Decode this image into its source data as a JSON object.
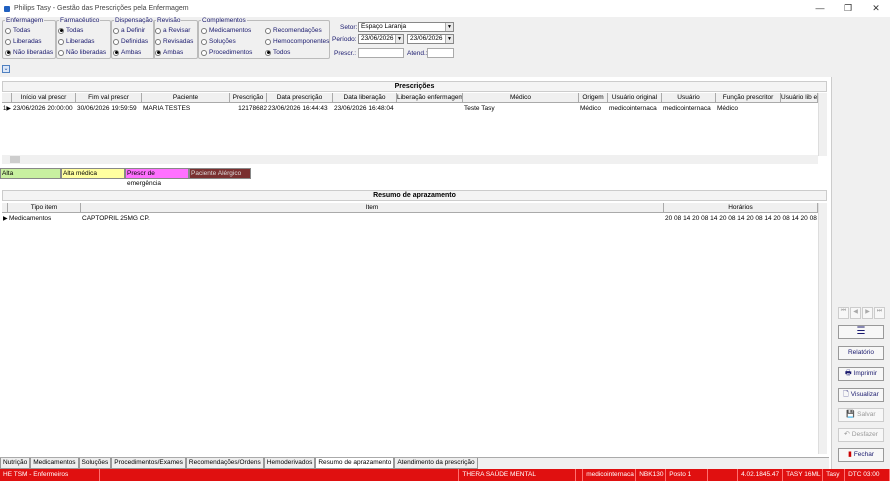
{
  "window": {
    "title": "Philips Tasy - Gestão das Prescrições pela Enfermagem",
    "controls": [
      "—",
      "❐",
      "✕"
    ]
  },
  "filters": {
    "enfermagem": {
      "label": "Enfermagem",
      "options": [
        "Todas",
        "Liberadas",
        "Não liberadas"
      ],
      "selected": 2
    },
    "farmaceutico": {
      "label": "Farmacêutico",
      "options": [
        "Todas",
        "Liberadas",
        "Não liberadas"
      ],
      "selected": 0
    },
    "dispensacao": {
      "label": "Dispensação",
      "options": [
        "a Definir",
        "Definidas",
        "Ambas"
      ],
      "selected": 2
    },
    "revisao": {
      "label": "Revisão",
      "options": [
        "a Revisar",
        "Revisadas",
        "Ambas"
      ],
      "selected": 2
    },
    "complementos": {
      "label": "Complementos",
      "options": [
        "Medicamentos",
        "Soluções",
        "Procedimentos",
        "Recomendações",
        "Hemocomponentes",
        "Todos"
      ],
      "selected": 5
    },
    "setor_label": "Setor:",
    "setor_value": "Espaço Laranja",
    "periodo_label": "Período:",
    "periodo_from": "23/06/2026",
    "periodo_to": "23/06/2026",
    "prescr_label": "Prescr.:",
    "atend_label": "Atend.:"
  },
  "prescricoes": {
    "title": "Prescrições",
    "columns": [
      "Início val prescr",
      "Fim val prescr",
      "Paciente",
      "Prescrição",
      "Data prescrição",
      "Data liberação",
      "Liberação enfermagem",
      "Médico",
      "Origem",
      "Usuário original",
      "Usuário",
      "Função prescritor",
      "Usuário lib enf"
    ],
    "rows": [
      [
        "23/06/2026 20:00:00",
        "30/06/2026 19:59:59",
        "MARIA TESTES",
        "12178682",
        "23/06/2026 16:44:43",
        "23/06/2026 16:48:04",
        "",
        "Teste Tasy",
        "Médico",
        "medicointernaca",
        "medicointernaca",
        "Médico",
        ""
      ]
    ]
  },
  "legend": [
    "Alta",
    "Alta médica",
    "Prescr de emergência",
    "Paciente Alérgico"
  ],
  "legend_colors": [
    "#c8f0a0",
    "#ffffa0",
    "#ff70ff",
    "#7a3030"
  ],
  "aprazamento": {
    "title": "Resumo de aprazamento",
    "columns": [
      "Tipo item",
      "Item",
      "Horários"
    ],
    "rows": [
      [
        "Medicamentos",
        "CAPTOPRIL 25MG CP.",
        "20 08 14 20 08 14 20 08 14 20 08 14 20 08 14 20 08"
      ]
    ]
  },
  "side_buttons": {
    "relatorio": "Relatório",
    "imprimir": "Imprimir",
    "visualizar": "Visualizar",
    "salvar": "Salvar",
    "desfazer": "Desfazer",
    "fechar": "Fechar"
  },
  "tabs": [
    "Nutrição",
    "Medicamentos",
    "Soluções",
    "Procedimentos/Exames",
    "Recomendações/Ordens",
    "Hemoderivados",
    "Resumo de aprazamento",
    "Atendimento da prescrição"
  ],
  "active_tab": 6,
  "status": [
    "HE TSM - Enfermeiros",
    "",
    "THERA SAÚDE MENTAL",
    "",
    "medicointernaca",
    "NBK130",
    "Posto 1",
    "",
    "4.02.1845.47",
    "TASY 16ML",
    "Tasy",
    "DTC 03:00"
  ]
}
